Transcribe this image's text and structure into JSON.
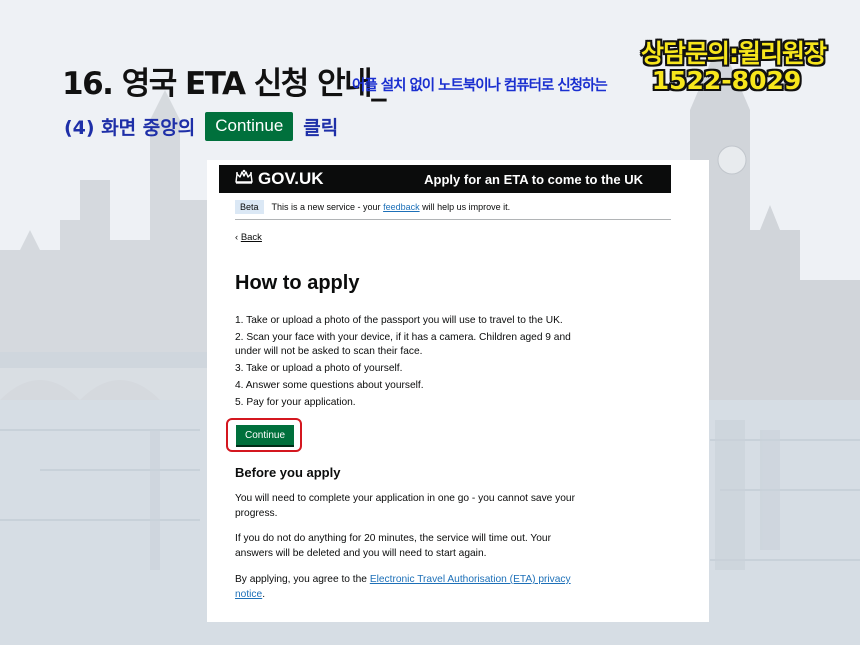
{
  "slide": {
    "title": "16. 영국 ETA 신청 안내_",
    "subtitle": "어플 설치 없이 노트북이나 컴퓨터로 신청하는",
    "contact_label": "상담문의:윌리원장",
    "contact_phone": "1522-8029",
    "step_prefix": "(4) 화면 중앙의",
    "step_chip": "Continue",
    "step_suffix": "클릭"
  },
  "gov": {
    "logo": "GOV.UK",
    "service_name": "Apply for an ETA to come to the UK",
    "phase_tag": "Beta",
    "phase_text_before": "This is a new service - your",
    "phase_link": "feedback",
    "phase_text_after": "will help us improve it.",
    "back_chevron": "‹",
    "back_label": "Back",
    "heading": "How to apply",
    "steps": [
      "1. Take or upload a photo of the passport you will use to travel to the UK.",
      "2. Scan your face with your device, if it has a camera. Children aged 9 and under will not be asked to scan their face.",
      "3. Take or upload a photo of yourself.",
      "4. Answer some questions about yourself.",
      "5. Pay for your application."
    ],
    "continue_label": "Continue",
    "before_heading": "Before you apply",
    "para1": "You will need to complete your application in one go - you cannot save your progress.",
    "para2": "If you do not do anything for 20 minutes, the service will time out. Your answers will be deleted and you will need to start again.",
    "para3_before": "By applying, you agree to the",
    "para3_link": "Electronic Travel Authorisation (ETA) privacy notice",
    "para3_after": "."
  },
  "icons": {
    "crown": "crown-icon"
  },
  "colors": {
    "gov_black": "#0b0c0c",
    "gov_green": "#00703c",
    "gov_link": "#1d70b8",
    "highlight_red": "#d4171f",
    "title_blue": "#1a2fd0",
    "contact_yellow": "#f7e61c"
  }
}
